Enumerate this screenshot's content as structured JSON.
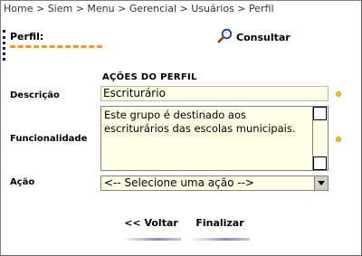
{
  "breadcrumb": "Home > Siem > Menu > Gerencial > Usuários > Perfil",
  "header": {
    "title": "Perfil:",
    "consult_label": "Consultar"
  },
  "form": {
    "section_title": "AÇÕES DO PERFIL",
    "description_label": "Descrição",
    "description_value": "Escriturário",
    "functionality_label": "Funcionalidade",
    "functionality_value": "Este grupo é destinado aos escriturários das escolas municipais.",
    "action_label": "Ação",
    "action_selected": "<-- Selecione uma ação -->"
  },
  "buttons": {
    "back_label": "<< Voltar",
    "finish_label": "Finalizar"
  },
  "colors": {
    "accent_underline": "#f29a1d",
    "field_background": "#ffffe6",
    "required_dot": "#f5c400"
  }
}
